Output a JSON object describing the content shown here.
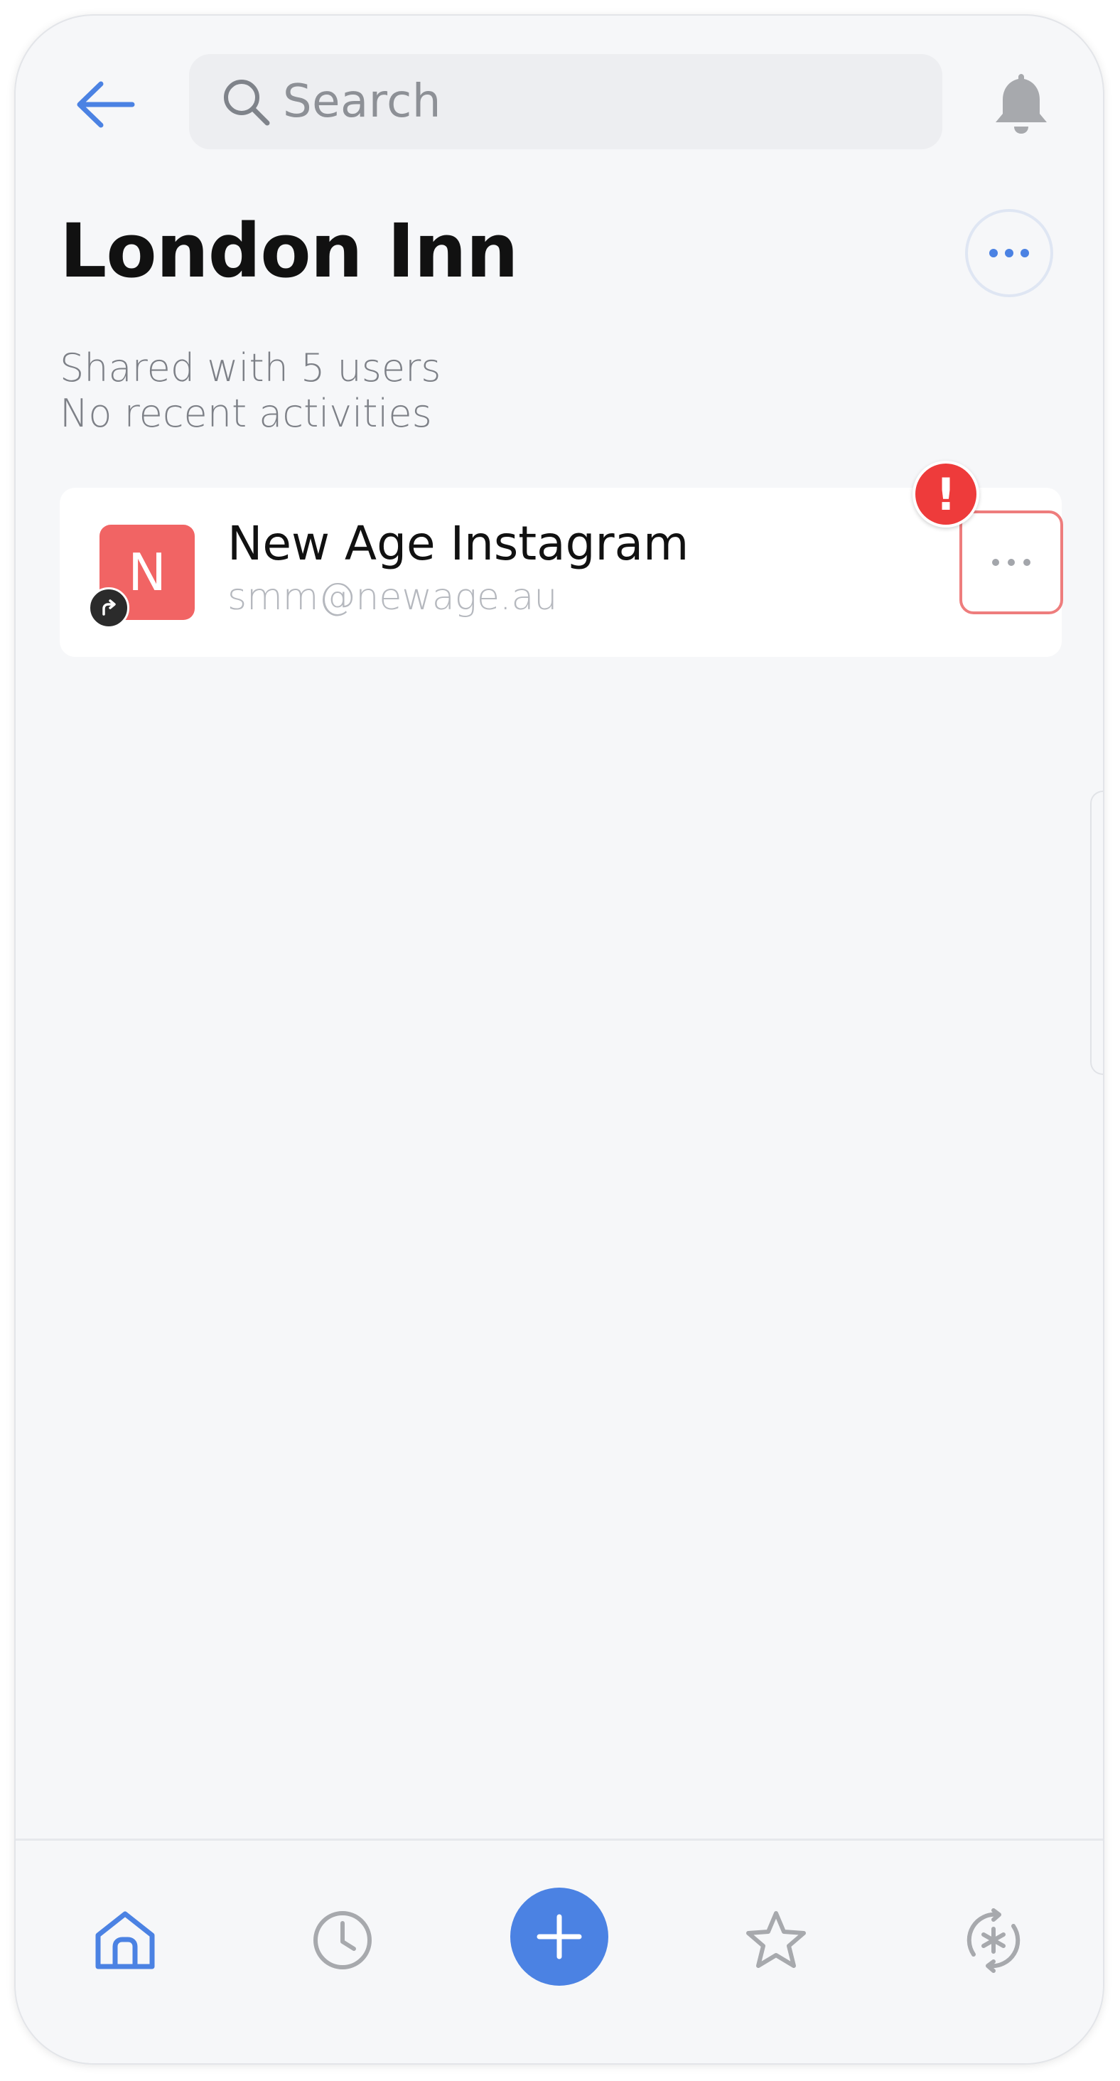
{
  "header": {
    "back_icon": "arrow-left-icon",
    "search": {
      "placeholder": "Search",
      "icon": "search-icon"
    },
    "notifications_icon": "bell-icon"
  },
  "vault": {
    "title": "London Inn",
    "more_icon": "more-horizontal-icon",
    "shared_text": "Shared with 5 users",
    "activity_text": "No recent activities"
  },
  "items": [
    {
      "avatar_letter": "N",
      "avatar_color": "#f16464",
      "shared_badge_icon": "share-arrow-icon",
      "name": "New Age Instagram",
      "subtitle": "smm@newage.au",
      "alert_mark": "!",
      "alert_color": "#ee3b3b",
      "more_icon": "more-horizontal-icon"
    }
  ],
  "bottom_nav": {
    "items": [
      {
        "icon": "home-icon",
        "active": true
      },
      {
        "icon": "clock-icon",
        "active": false
      },
      {
        "icon": "plus-icon",
        "active": false
      },
      {
        "icon": "star-icon",
        "active": false
      },
      {
        "icon": "generator-icon",
        "active": false
      }
    ]
  },
  "colors": {
    "accent": "#4b82e3",
    "background": "#f6f7f9",
    "alert": "#ee3b3b"
  }
}
